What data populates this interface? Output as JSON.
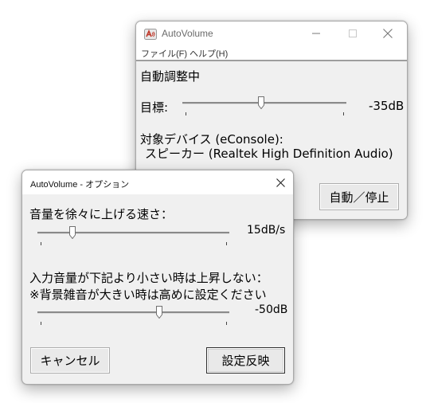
{
  "main_window": {
    "title": "AutoVolume",
    "menu": [
      "ファイル(F)",
      "ヘルプ(H)"
    ],
    "status": "自動調整中",
    "target_label": "目標:",
    "target_value": "-35dB",
    "target_level_fraction": 0.48,
    "device_label": "対象デバイス (eConsole):",
    "device_name": "スピーカー (Realtek High Definition Audio)",
    "toggle_button": "自動／停止"
  },
  "options_window": {
    "title": "AutoVolume - オプション",
    "rise_speed_label": "音量を徐々に上げる速さ：",
    "rise_speed_value": "15dB/s",
    "rise_speed_fraction": 0.17,
    "threshold_label_1": "入力音量が下記より小さい時は上昇しない：",
    "threshold_label_2": "※背景雑音が大きい時は高めに設定ください",
    "threshold_value": "-50dB",
    "threshold_fraction": 0.64,
    "cancel_button": "キャンセル",
    "apply_button": "設定反映"
  },
  "colors": {
    "client_bg": "#f0f0f0",
    "title_text": "#6b6b6b",
    "app_icon_red": "#c0392b"
  },
  "icons": [
    "autovolume-app-icon",
    "minimize-icon",
    "maximize-icon",
    "close-icon"
  ]
}
